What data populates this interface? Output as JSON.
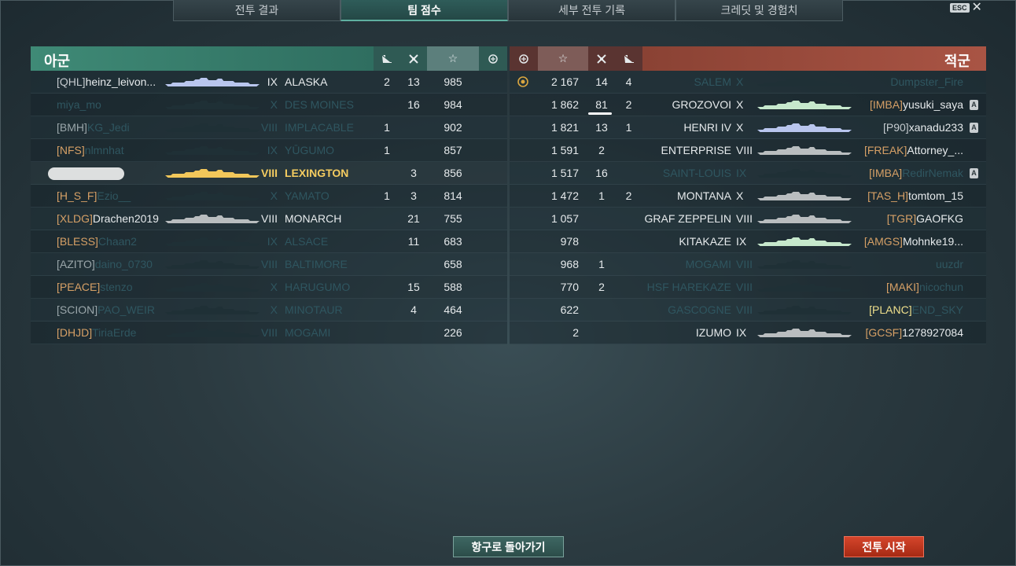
{
  "tabs": [
    "전투 결과",
    "팀 점수",
    "세부 전투 기록",
    "크레딧 및 경험치"
  ],
  "esc_key": "ESC",
  "allies": {
    "title": "아군",
    "rows": [
      {
        "clan": "[QHL]",
        "name": "heinz_leivon...",
        "tier": "IX",
        "ship": "ALASKA",
        "c1": "2",
        "c2": "13",
        "score": "985",
        "dead": false,
        "white": true,
        "color": "#b9c6ee"
      },
      {
        "clan": "",
        "name": "miya_mo",
        "tier": "X",
        "ship": "DES MOINES",
        "c1": "",
        "c2": "16",
        "score": "984",
        "dead": true,
        "white": false,
        "color": "#1f3036"
      },
      {
        "clan": "[BMH]",
        "name": "KG_Jedi",
        "tier": "VIII",
        "ship": "IMPLACABLE",
        "c1": "1",
        "c2": "",
        "score": "902",
        "dead": true,
        "white": true,
        "color": "#1f3036"
      },
      {
        "clan": "[NFS]",
        "name": "nlmnhat",
        "tier": "IX",
        "ship": "YŪGUMO",
        "c1": "1",
        "c2": "",
        "score": "857",
        "dead": true,
        "white": false,
        "color": "#1f3036"
      },
      {
        "clan": "",
        "name": "",
        "tier": "VIII",
        "ship": "LEXINGTON",
        "c1": "",
        "c2": "3",
        "score": "856",
        "dead": false,
        "mine": true,
        "white": false,
        "color": "#f2c75a"
      },
      {
        "clan": "[H_S_F]",
        "name": "Ezio__",
        "tier": "X",
        "ship": "YAMATO",
        "c1": "1",
        "c2": "3",
        "score": "814",
        "dead": true,
        "white": false,
        "color": "#1f3036"
      },
      {
        "clan": "[XLDG]",
        "name": "Drachen2019",
        "tier": "VIII",
        "ship": "MONARCH",
        "c1": "",
        "c2": "21",
        "score": "755",
        "dead": false,
        "white": false,
        "color": "#b9bdbf"
      },
      {
        "clan": "[BLESS]",
        "name": "Chaan2",
        "tier": "IX",
        "ship": "ALSACE",
        "c1": "",
        "c2": "11",
        "score": "683",
        "dead": true,
        "white": false,
        "color": "#1f3036"
      },
      {
        "clan": "[AZITO]",
        "name": "daino_0730",
        "tier": "VIII",
        "ship": "BALTIMORE",
        "c1": "",
        "c2": "",
        "score": "658",
        "dead": true,
        "white": true,
        "color": "#1f3036"
      },
      {
        "clan": "[PEACE]",
        "name": "stenzo",
        "tier": "X",
        "ship": "HARUGUMO",
        "c1": "",
        "c2": "15",
        "score": "588",
        "dead": true,
        "white": false,
        "color": "#1f3036"
      },
      {
        "clan": "[SCION]",
        "name": "PAO_WEIR",
        "tier": "X",
        "ship": "MINOTAUR",
        "c1": "",
        "c2": "4",
        "score": "464",
        "dead": true,
        "white": true,
        "color": "#1f3036"
      },
      {
        "clan": "[DHJD]",
        "name": "TiriaErde",
        "tier": "VIII",
        "ship": "MOGAMI",
        "c1": "",
        "c2": "",
        "score": "226",
        "dead": true,
        "white": false,
        "color": "#1f3036"
      }
    ]
  },
  "enemies": {
    "title": "적군",
    "rows": [
      {
        "clan": "",
        "name": "Dumpster_Fire",
        "tier": "X",
        "ship": "SALEM",
        "c1": "14",
        "c2": "4",
        "score": "2 167",
        "dead": true,
        "medal": true,
        "badge": false,
        "color": "#1f3036"
      },
      {
        "clan": "[IMBA]",
        "name": "yusuki_saya",
        "tier": "X",
        "ship": "GROZOVOI",
        "c1": "81",
        "c2": "2",
        "score": "1 862",
        "dead": false,
        "badge": true,
        "underline": true,
        "color": "#c6e8cc"
      },
      {
        "clan": "[P90]",
        "name": "xanadu233",
        "tier": "X",
        "ship": "HENRI IV",
        "c1": "13",
        "c2": "1",
        "score": "1 821",
        "dead": false,
        "badge": true,
        "white": true,
        "color": "#b9c6ee"
      },
      {
        "clan": "[FREAK]",
        "name": "Attorney_...",
        "tier": "VIII",
        "ship": "ENTERPRISE",
        "c1": "2",
        "c2": "",
        "score": "1 591",
        "dead": false,
        "color": "#b9bdbf"
      },
      {
        "clan": "[IMBA]",
        "name": "RedirNemak",
        "tier": "IX",
        "ship": "SAINT-LOUIS",
        "c1": "16",
        "c2": "",
        "score": "1 517",
        "dead": true,
        "badge": true,
        "color": "#1f3036"
      },
      {
        "clan": "[TAS_H]",
        "name": "tomtom_15",
        "tier": "X",
        "ship": "MONTANA",
        "c1": "1",
        "c2": "2",
        "score": "1 472",
        "dead": false,
        "color": "#b9bdbf"
      },
      {
        "clan": "[TGR]",
        "name": "GAOFKG",
        "tier": "VIII",
        "ship": "GRAF ZEPPELIN",
        "c1": "",
        "c2": "",
        "score": "1 057",
        "dead": false,
        "color": "#b9bdbf"
      },
      {
        "clan": "[AMGS]",
        "name": "Mohnke19...",
        "tier": "IX",
        "ship": "KITAKAZE",
        "c1": "",
        "c2": "",
        "score": "978",
        "dead": false,
        "color": "#c6e8cc"
      },
      {
        "clan": "",
        "name": "uuzdr",
        "tier": "VIII",
        "ship": "MOGAMI",
        "c1": "1",
        "c2": "",
        "score": "968",
        "dead": true,
        "color": "#1f3036"
      },
      {
        "clan": "[MAKI]",
        "name": "nicochun",
        "tier": "VIII",
        "ship": "HSF HAREKAZE",
        "c1": "2",
        "c2": "",
        "score": "770",
        "dead": true,
        "color": "#1f3036"
      },
      {
        "clan": "[PLANC]",
        "name": "END_SKY",
        "tier": "VIII",
        "ship": "GASCOGNE",
        "c1": "",
        "c2": "",
        "score": "622",
        "dead": true,
        "yellowclan": true,
        "color": "#1f3036"
      },
      {
        "clan": "[GCSF]",
        "name": "1278927084",
        "tier": "IX",
        "ship": "IZUMO",
        "c1": "",
        "c2": "",
        "score": "2",
        "dead": false,
        "color": "#b9bdbf"
      }
    ]
  },
  "buttons": {
    "port": "항구로 돌아가기",
    "battle": "전투 시작"
  },
  "colors": {
    "ally": "#3f8a76",
    "enemy": "#a95444",
    "clan": "#d6a066",
    "mine": "#f4cc60",
    "battle": "#c43a20"
  }
}
